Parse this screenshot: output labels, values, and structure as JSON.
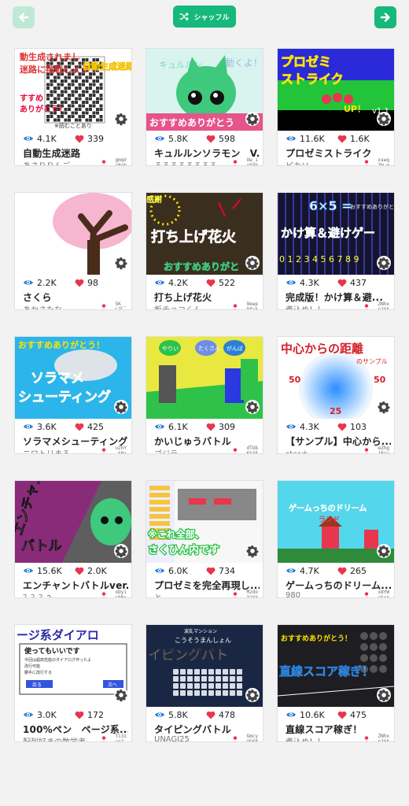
{
  "toolbar": {
    "shuffle_label": "シャッフル",
    "back_icon": "arrow-left-icon",
    "forward_icon": "arrow-right-icon",
    "shuffle_icon": "shuffle-icon"
  },
  "colors": {
    "accent": "#16b97b",
    "accent_disabled": "#bfe9d7",
    "like": "#e8364f",
    "view": "#2a7fd6"
  },
  "cards": [
    {
      "views": "4.1K",
      "likes": "339",
      "title": "自動生成迷路",
      "author": "あさりりんご",
      "uid1": "gmqV",
      "uid2": "xRgb",
      "thumb_texts": [
        "動生成されまし",
        "迷路に挑戦しよう",
        "自動生成迷路",
        "すすめ",
        "ありがとう！",
        "※読むことあり"
      ]
    },
    {
      "views": "5.8K",
      "likes": "598",
      "title": "キュルルンソラモン　V...",
      "author": "るるるるるるるる...",
      "uid1": "Uw_i",
      "uid2": "r94b",
      "thumb_texts": [
        "キュルルン",
        "動くよ！",
        "おすすめありがとう"
      ]
    },
    {
      "views": "11.6K",
      "likes": "1.6K",
      "title": "プロゼミストライク",
      "author": "ピカソ",
      "uid1": "xswq",
      "uid2": "TW_m",
      "thumb_texts": [
        "プロゼミ",
        "ストライク",
        "UP！",
        "v1.1"
      ]
    },
    {
      "views": "2.2K",
      "likes": "98",
      "title": "さくら",
      "author": "あかさたな",
      "uid1": "SK__",
      "uid2": "LZL-",
      "thumb_texts": []
    },
    {
      "views": "4.2K",
      "likes": "522",
      "title": "打ち上げ花火",
      "author": "板チョコくん",
      "uid1": "9ewp",
      "uid2": "Dfsk",
      "thumb_texts": [
        "感謝",
        "打ち上げ花火",
        "おすすめありがと"
      ]
    },
    {
      "views": "4.3K",
      "likes": "437",
      "title": "完成版！かけ算＆避...",
      "author": "煮込め！！",
      "uid1": "ZNhx",
      "uid2": "nJSb",
      "thumb_texts": [
        "6×5 =",
        "おすすめありがとう！",
        "かけ算＆避けゲー",
        "0 1 2 3 4 5 6 7 8 9"
      ]
    },
    {
      "views": "3.6K",
      "likes": "425",
      "title": "ソラマメシューティング",
      "author": "ニワトリまる。",
      "uid1": "uzhY",
      "uid2": "_kPx",
      "thumb_texts": [
        "おすすめありがとう！",
        "ソラマメ",
        "シューティング"
      ]
    },
    {
      "views": "6.1K",
      "likes": "309",
      "title": "かいじゅうバトル",
      "author": "ゴジラ",
      "uid1": "dTUb",
      "uid2": "Kk3F",
      "thumb_texts": [
        "やりい",
        "たくさん",
        "がんば"
      ]
    },
    {
      "views": "4.3K",
      "likes": "103",
      "title": "【サンプル】中心から...",
      "author": "star＊",
      "uid1": "eZhg",
      "uid2": "1Bcw",
      "thumb_texts": [
        "中心からの距離",
        "のサンプル",
        "50",
        "50",
        "25"
      ]
    },
    {
      "views": "15.6K",
      "likes": "2.0K",
      "title": "エンチャントバトルver...",
      "author": "？？？2",
      "uid1": "oDyi",
      "uid2": "sbNx",
      "thumb_texts": [
        "エンチャント",
        "バトル"
      ]
    },
    {
      "views": "6.0K",
      "likes": "734",
      "title": "プロゼミを完全再現し...",
      "author": "と",
      "uid1": "M2do",
      "uid2": "3zYX",
      "thumb_texts": [
        "※これ全部、",
        "さくひん内です"
      ]
    },
    {
      "views": "4.7K",
      "likes": "265",
      "title": "ゲームっちのドリーム...",
      "author": "980",
      "uid1": "x8YW",
      "uid2": "rtsp",
      "thumb_texts": [
        "ゲームっちのドリーム",
        "ランド"
      ]
    },
    {
      "views": "3.0K",
      "likes": "172",
      "title": "100%ペン　ページ系...",
      "author": "配列好きの数学者",
      "uid1": "Ti3z",
      "uid2": "ue2-",
      "thumb_texts": [
        "ージ系ダイアロ",
        "使ってもいいです",
        "今回は超高性能のダイアログ作ったよ",
        "改行可能",
        "勝手に改行する",
        "戻る",
        "次へ"
      ]
    },
    {
      "views": "5.8K",
      "likes": "478",
      "title": "タイピングバトル",
      "author": "UNAGI25",
      "uid1": "Gmcy",
      "uid2": "UG68",
      "thumb_texts": [
        "波乱マンション",
        "こうそうまんしょん",
        "イピングバト"
      ]
    },
    {
      "views": "10.6K",
      "likes": "475",
      "title": "直線スコア稼ぎ！",
      "author": "煮込め！！",
      "uid1": "ZNhx",
      "uid2": "nJSb",
      "thumb_texts": [
        "おすすめありがとう！",
        "直線スコア稼ぎ！"
      ]
    }
  ]
}
